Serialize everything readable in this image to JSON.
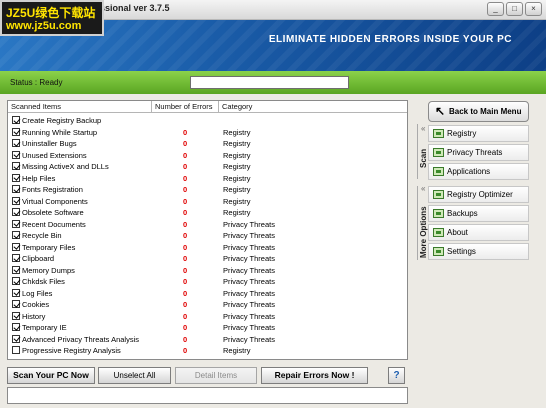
{
  "window": {
    "title": "ssional ver 3.7.5",
    "controls": [
      "_",
      "□",
      "×"
    ]
  },
  "watermark": {
    "line1": "JZ5U绿色下载站",
    "line2": "www.jz5u.com"
  },
  "banner": {
    "text": "ELIMINATE HIDDEN ERRORS INSIDE YOUR PC"
  },
  "status": {
    "label": "Status : Ready",
    "value": ""
  },
  "list": {
    "headers": [
      "Scanned Items",
      "Number of Errors",
      "Category"
    ],
    "rows": [
      {
        "name": "Create Registry Backup",
        "errors": "",
        "category": "",
        "checked": true
      },
      {
        "name": "Running While Startup",
        "errors": "0",
        "category": "Registry",
        "checked": true
      },
      {
        "name": "Uninstaller Bugs",
        "errors": "0",
        "category": "Registry",
        "checked": true
      },
      {
        "name": "Unused Extensions",
        "errors": "0",
        "category": "Registry",
        "checked": true
      },
      {
        "name": "Missing ActiveX and DLLs",
        "errors": "0",
        "category": "Registry",
        "checked": true
      },
      {
        "name": "Help Files",
        "errors": "0",
        "category": "Registry",
        "checked": true
      },
      {
        "name": "Fonts Registration",
        "errors": "0",
        "category": "Registry",
        "checked": true
      },
      {
        "name": "Virtual Components",
        "errors": "0",
        "category": "Registry",
        "checked": true
      },
      {
        "name": "Obsolete Software",
        "errors": "0",
        "category": "Registry",
        "checked": true
      },
      {
        "name": "Recent Documents",
        "errors": "0",
        "category": "Privacy Threats",
        "checked": true
      },
      {
        "name": "Recycle Bin",
        "errors": "0",
        "category": "Privacy Threats",
        "checked": true
      },
      {
        "name": "Temporary Files",
        "errors": "0",
        "category": "Privacy Threats",
        "checked": true
      },
      {
        "name": "Clipboard",
        "errors": "0",
        "category": "Privacy Threats",
        "checked": true
      },
      {
        "name": "Memory Dumps",
        "errors": "0",
        "category": "Privacy Threats",
        "checked": true
      },
      {
        "name": "Chkdsk Files",
        "errors": "0",
        "category": "Privacy Threats",
        "checked": true
      },
      {
        "name": "Log Files",
        "errors": "0",
        "category": "Privacy Threats",
        "checked": true
      },
      {
        "name": "Cookies",
        "errors": "0",
        "category": "Privacy Threats",
        "checked": true
      },
      {
        "name": "History",
        "errors": "0",
        "category": "Privacy Threats",
        "checked": true
      },
      {
        "name": "Temporary IE",
        "errors": "0",
        "category": "Privacy Threats",
        "checked": true
      },
      {
        "name": "Advanced Privacy Threats Analysis",
        "errors": "0",
        "category": "Privacy Threats",
        "checked": true
      },
      {
        "name": "Progressive Registry Analysis",
        "errors": "0",
        "category": "Registry",
        "checked": false
      }
    ]
  },
  "buttons": {
    "scan": "Scan Your PC Now",
    "unselect": "Unselect All",
    "detail": "Detail Items",
    "repair": "Repair Errors Now !",
    "help": "?"
  },
  "sidebar": {
    "back": "Back to Main Menu",
    "scan_label": "Scan",
    "more_label": "More Options",
    "scan_items": [
      "Registry",
      "Privacy Threats",
      "Applications"
    ],
    "more_items": [
      "Registry Optimizer",
      "Backups",
      "About",
      "Settings"
    ]
  },
  "colors": {
    "banner_blue": "#1a5ca8",
    "status_green": "#6cb52f",
    "error_red": "#e00000"
  }
}
